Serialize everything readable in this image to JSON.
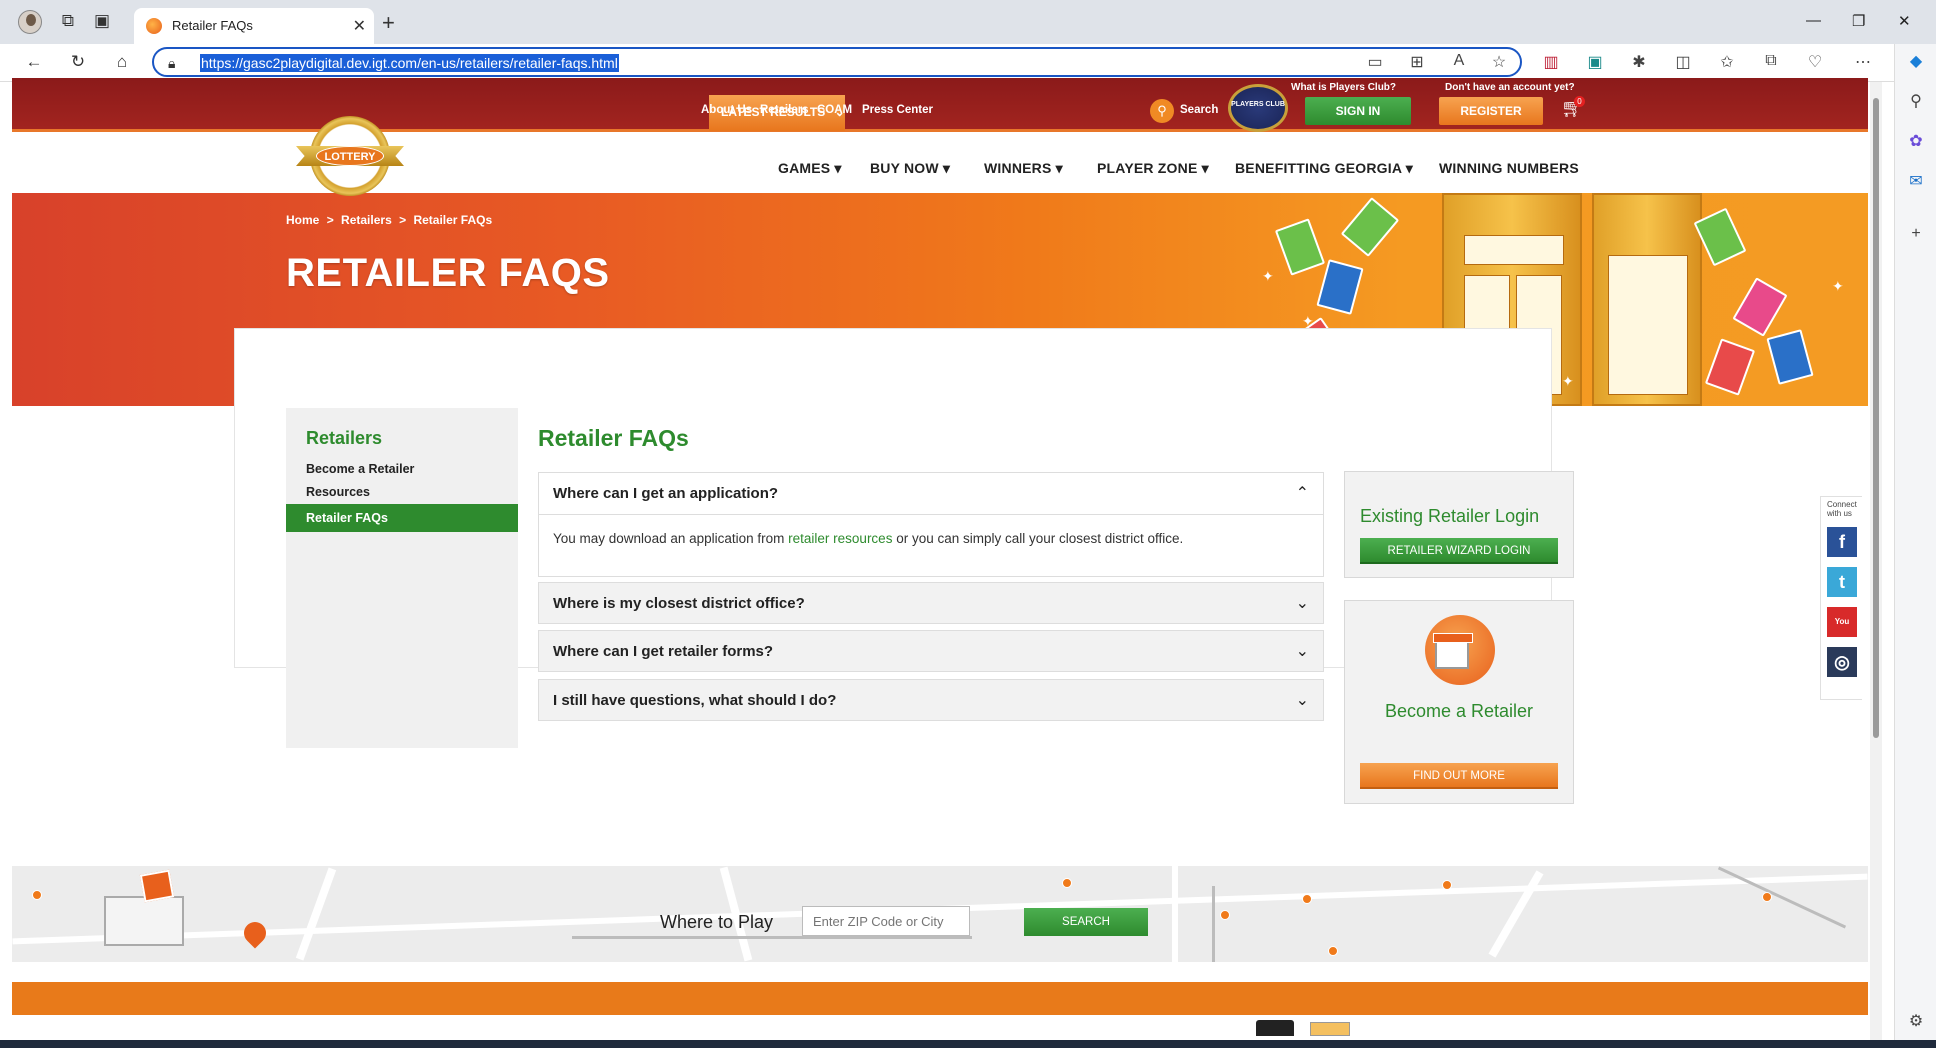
{
  "browser": {
    "tab_title": "Retailer FAQs",
    "url": "https://gasc2playdigital.dev.igt.com/en-us/retailers/retailer-faqs.html"
  },
  "topbar": {
    "latest_results": "LATEST RESULTS",
    "links": [
      "About Us",
      "Retailers",
      "COAM",
      "Press Center"
    ],
    "search_label": "Search",
    "players_club_badge": "PLAYERS CLUB",
    "players_club_question": "What is Players Club?",
    "signin": "SIGN IN",
    "account_question": "Don't have an account yet?",
    "register": "REGISTER",
    "cart_count": "0"
  },
  "logo": {
    "text": "LOTTERY"
  },
  "nav": {
    "items": [
      "GAMES",
      "BUY NOW",
      "WINNERS",
      "PLAYER ZONE",
      "BENEFITTING GEORGIA",
      "WINNING NUMBERS"
    ]
  },
  "hero": {
    "breadcrumb": [
      "Home",
      "Retailers",
      "Retailer FAQs"
    ],
    "breadcrumb_sep": ">",
    "title": "RETAILER FAQS"
  },
  "sidebar": {
    "heading": "Retailers",
    "links": [
      "Become a Retailer",
      "Resources",
      "Retailer FAQs"
    ]
  },
  "faq": {
    "title": "Retailer FAQs",
    "items": [
      {
        "question": "Where can I get an application?",
        "answer_before": "You may download an application from ",
        "answer_link": "retailer resources",
        "answer_after": " or you can simply call your closest district office."
      },
      {
        "question": "Where is my closest district office?"
      },
      {
        "question": "Where can I get retailer forms?"
      },
      {
        "question": "I still have questions, what should I do?"
      }
    ]
  },
  "cards": {
    "login_title": "Existing Retailer Login",
    "login_button": "RETAILER WIZARD LOGIN",
    "become_title": "Become a Retailer",
    "findout_button": "FIND OUT MORE"
  },
  "social": {
    "label_line1": "Connect",
    "label_line2": "with us",
    "facebook": "f",
    "twitter": "t",
    "youtube": "You Tube",
    "instagram": "◎"
  },
  "map": {
    "where_label": "Where to Play",
    "zip_placeholder": "Enter ZIP Code or City",
    "search_button": "SEARCH"
  },
  "colors": {
    "brand_green": "#2e8b2e",
    "brand_orange": "#e8761d",
    "topbar_red": "#8b1a1a"
  }
}
